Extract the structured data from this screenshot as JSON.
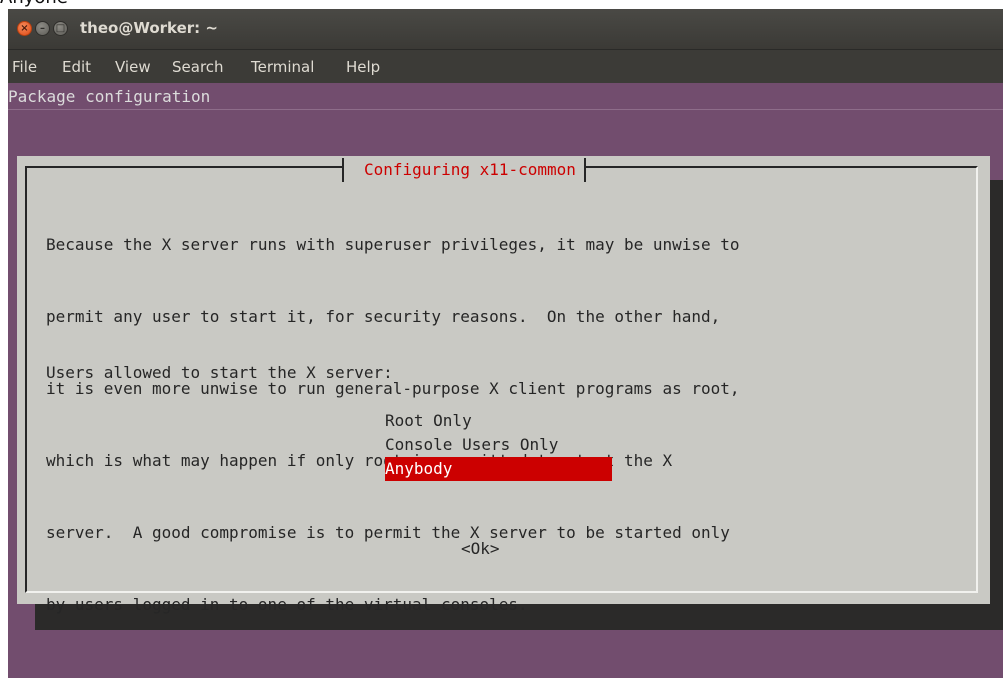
{
  "caption_fragment": "Anyone",
  "window": {
    "title": "theo@Worker: ~",
    "buttons": {
      "close": "×",
      "minimize": "–",
      "maximize": "□"
    }
  },
  "menu": [
    "File",
    "Edit",
    "View",
    "Search",
    "Terminal",
    "Help"
  ],
  "terminal": {
    "header": "Package configuration"
  },
  "dialog": {
    "title": "Configuring x11-common",
    "body_lines": [
      "Because the X server runs with superuser privileges, it may be unwise to",
      "permit any user to start it, for security reasons.  On the other hand,",
      "it is even more unwise to run general-purpose X client programs as root,",
      "which is what may happen if only root is permitted to start the X",
      "server.  A good compromise is to permit the X server to be started only",
      "by users logged in to one of the virtual consoles."
    ],
    "question": "Users allowed to start the X server:",
    "options": [
      "Root Only",
      "Console Users Only",
      "Anybody"
    ],
    "selected_option": "Anybody",
    "ok_label": "<Ok>"
  },
  "colors": {
    "terminal_background": "#724d6e",
    "dialog_background": "#c9c9c4",
    "highlight": "#cc0000",
    "title_text": "#cc0000"
  }
}
